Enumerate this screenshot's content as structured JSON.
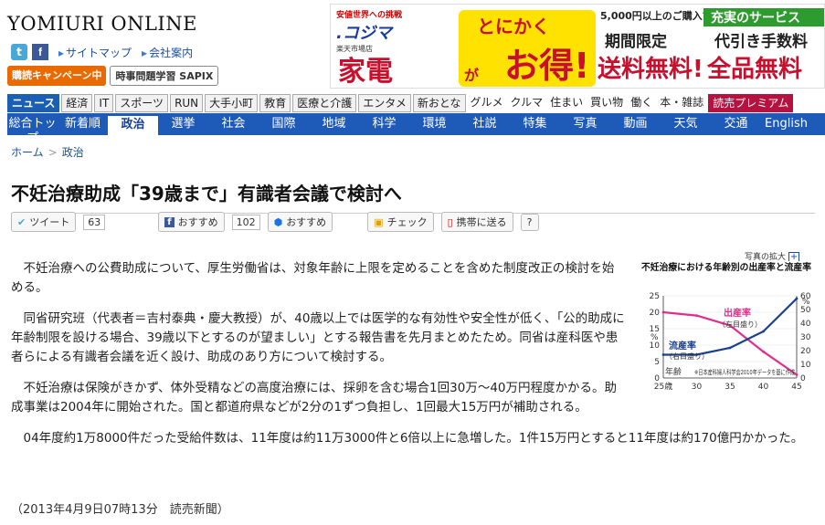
{
  "site": {
    "logo": "YOMIURI ONLINE",
    "links": [
      "サイトマップ",
      "会社案内"
    ],
    "promos": [
      "購読キャンペーン中",
      "時事問題学習 SAPIX"
    ]
  },
  "ad": {
    "shop_tag": "安値世界への挑戦",
    "shop_name": ".コジマ",
    "shop_sub": "楽天市場店",
    "kaden": "家電",
    "tonikaku": "とにかく",
    "otoku": "お得!",
    "ga": "が",
    "condition": "5,000円以上のご購入で",
    "period": "期間限定",
    "free_ship": "送料無料!",
    "green": "充実のサービス",
    "fee": "代引き手数料",
    "free_all": "全品無料"
  },
  "tabs": [
    {
      "label": "ニュース",
      "style": "active"
    },
    {
      "label": "経済",
      "style": ""
    },
    {
      "label": "IT",
      "style": ""
    },
    {
      "label": "スポーツ",
      "style": ""
    },
    {
      "label": "RUN",
      "style": ""
    },
    {
      "label": "大手小町",
      "style": ""
    },
    {
      "label": "教育",
      "style": ""
    },
    {
      "label": "医療と介護",
      "style": ""
    },
    {
      "label": "エンタメ",
      "style": ""
    },
    {
      "label": "新おとな",
      "style": ""
    },
    {
      "label": "グルメ",
      "style": "plain"
    },
    {
      "label": "クルマ",
      "style": "plain"
    },
    {
      "label": "住まい",
      "style": "plain"
    },
    {
      "label": "買い物",
      "style": "plain"
    },
    {
      "label": "働く",
      "style": "plain"
    },
    {
      "label": "本・雑誌",
      "style": "plain"
    },
    {
      "label": "読売プレミアム",
      "style": "premium"
    }
  ],
  "subnav": [
    "総合トップ",
    "新着順",
    "政治",
    "選挙",
    "社会",
    "国際",
    "地域",
    "科学",
    "環境",
    "社説",
    "特集",
    "写真",
    "動画",
    "天気",
    "交通",
    "English"
  ],
  "subnav_active": "政治",
  "breadcrumb": {
    "home": "ホーム",
    "current": "政治"
  },
  "article": {
    "title": "不妊治療助成「39歳まで」有識者会議で検討へ",
    "paragraphs": [
      "不妊治療への公費助成について、厚生労働省は、対象年齢に上限を定めることを含めた制度改正の検討を始める。",
      "同省研究班（代表者＝吉村泰典・慶大教授）が、40歳以上では医学的な有効性や安全性が低く、「公的助成に年齢制限を設ける場合、39歳以下とするのが望ましい」とする報告書を先月まとめたため。同省は産科医や患者らによる有識者会議を近く設け、助成のあり方について検討する。",
      "不妊治療は保険がきかず、体外受精などの高度治療には、採卵を含む場合1回30万〜40万円程度かかる。助成事業は2004年に開始された。国と都道府県などが2分の1ずつ負担し、1回最大15万円が補助される。",
      "04年度約1万8000件だった受給件数は、11年度は約11万3000件と6倍以上に急増した。1件15万円とすると11年度は約170億円かかった。"
    ],
    "dateline": "（2013年4月9日07時13分　読売新聞）"
  },
  "share": {
    "tweet_label": "ツイート",
    "tweet_count": "63",
    "fb_label": "おすすめ",
    "fb_count": "102",
    "g_label": "おすすめ",
    "check_label": "チェック",
    "mobile_label": "携帯に送る",
    "help": "?"
  },
  "photo": {
    "enlarge": "写真の拡大"
  },
  "chart_data": {
    "type": "line",
    "title": "不妊治療における年齢別の出産率と流産率",
    "x": [
      25,
      30,
      35,
      40,
      45
    ],
    "x_ticks": [
      "25歳",
      "30",
      "35",
      "40",
      "45"
    ],
    "xlabel": "年齢",
    "series": [
      {
        "name": "出産率",
        "sub": "（左目盛り）",
        "axis": "left",
        "color": "#e0308f",
        "values": [
          20,
          19,
          16,
          8,
          1
        ]
      },
      {
        "name": "流産率",
        "sub": "（右目盛り）",
        "axis": "right",
        "color": "#1a3f8f",
        "values": [
          17,
          17,
          22,
          34,
          58
        ]
      }
    ],
    "y_left": {
      "ticks": [
        0,
        5,
        10,
        15,
        20,
        25
      ],
      "unit": "%",
      "lim": [
        0,
        25
      ]
    },
    "y_right": {
      "ticks": [
        0,
        10,
        20,
        30,
        40,
        50,
        60
      ],
      "unit": "%",
      "lim": [
        0,
        60
      ]
    },
    "source": "※日本産科婦人科学会2010年データを基に作成",
    "colors": {
      "birth": "#e0308f",
      "miscarriage": "#1a3f8f"
    }
  }
}
